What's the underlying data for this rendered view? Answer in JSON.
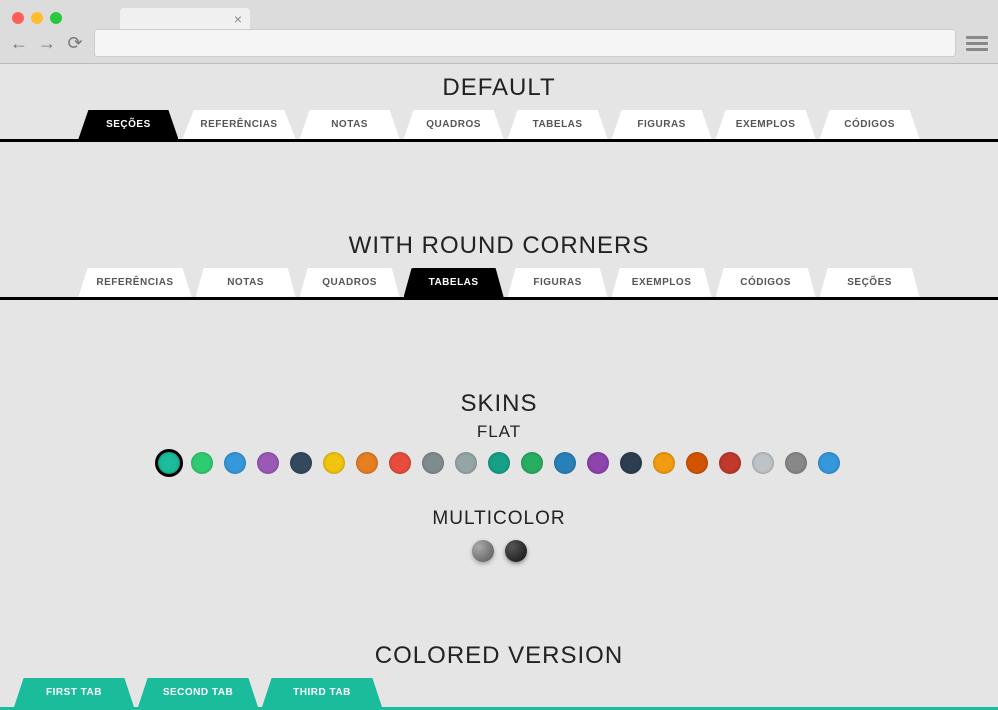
{
  "sections": {
    "default": {
      "title": "DEFAULT"
    },
    "round": {
      "title": "WITH ROUND CORNERS"
    },
    "skins": {
      "title": "SKINS",
      "flat": "FLAT",
      "multicolor": "MULTICOLOR"
    },
    "colored": {
      "title": "COLORED VERSION"
    }
  },
  "tabs_default": [
    {
      "label": "SEÇÕES",
      "active": true
    },
    {
      "label": "REFERÊNCIAS"
    },
    {
      "label": "NOTAS"
    },
    {
      "label": "QUADROS"
    },
    {
      "label": "TABELAS"
    },
    {
      "label": "FIGURAS"
    },
    {
      "label": "EXEMPLOS"
    },
    {
      "label": "CÓDIGOS"
    }
  ],
  "tabs_round": [
    {
      "label": "REFERÊNCIAS"
    },
    {
      "label": "NOTAS"
    },
    {
      "label": "QUADROS"
    },
    {
      "label": "TABELAS",
      "active": true
    },
    {
      "label": "FIGURAS"
    },
    {
      "label": "EXEMPLOS"
    },
    {
      "label": "CÓDIGOS"
    },
    {
      "label": "SEÇÕES"
    }
  ],
  "swatches_flat": [
    {
      "color": "#1abc9c",
      "selected": true
    },
    {
      "color": "#2ecc71"
    },
    {
      "color": "#3498db"
    },
    {
      "color": "#9b59b6"
    },
    {
      "color": "#34495e"
    },
    {
      "color": "#f1c40f"
    },
    {
      "color": "#e67e22"
    },
    {
      "color": "#e74c3c"
    },
    {
      "color": "#7f8c8d"
    },
    {
      "color": "#95a5a6"
    },
    {
      "color": "#16a085"
    },
    {
      "color": "#27ae60"
    },
    {
      "color": "#2980b9"
    },
    {
      "color": "#8e44ad"
    },
    {
      "color": "#2c3e50"
    },
    {
      "color": "#f39c12"
    },
    {
      "color": "#d35400"
    },
    {
      "color": "#c0392b"
    },
    {
      "color": "#bdc3c7"
    },
    {
      "color": "#888888"
    },
    {
      "color": "#3498db"
    }
  ],
  "tabs_colored": [
    {
      "label": "FIRST TAB"
    },
    {
      "label": "SECOND TAB"
    },
    {
      "label": "THIRD TAB"
    }
  ]
}
